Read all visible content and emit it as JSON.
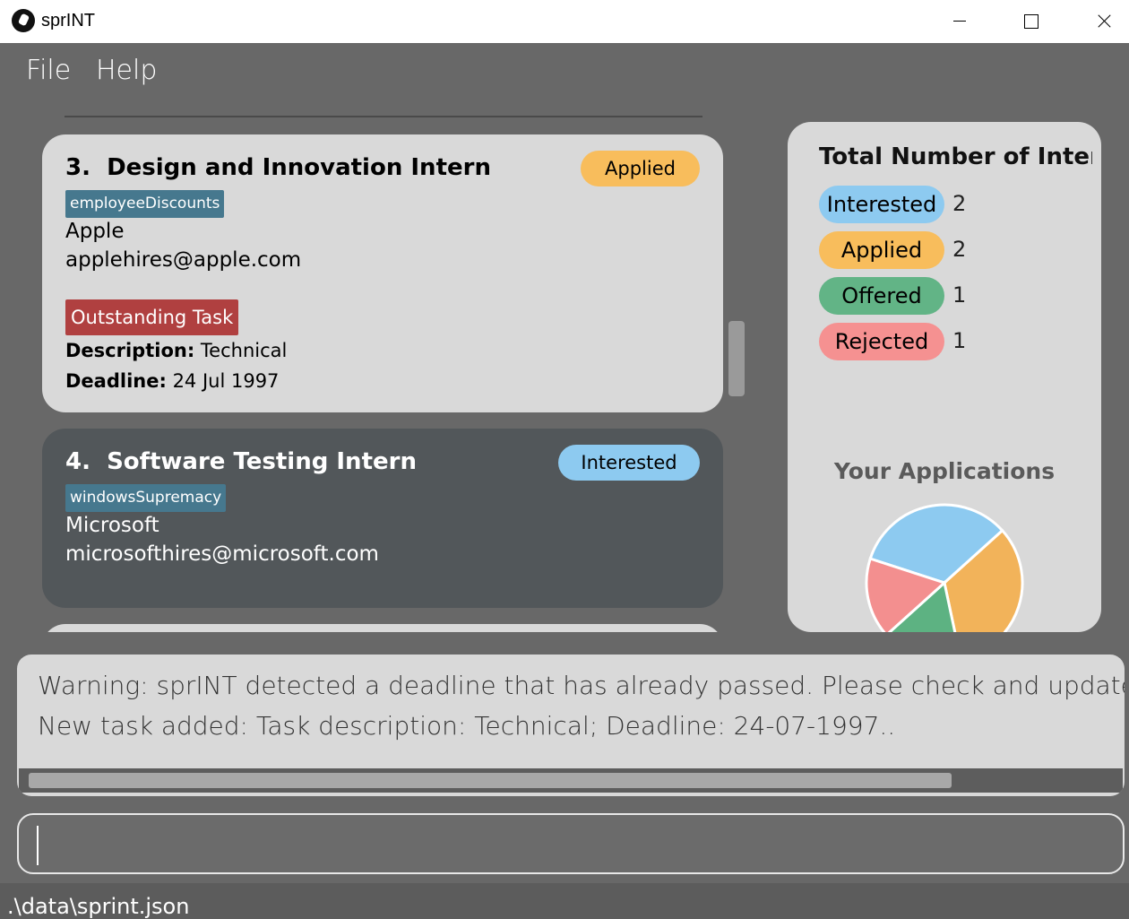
{
  "window": {
    "title": "sprINT",
    "icon": "runner-icon"
  },
  "menu": {
    "items": [
      "File",
      "Help"
    ]
  },
  "applications": [
    {
      "index": "3.",
      "role": "Design and Innovation Intern",
      "status": "Applied",
      "tag": "employeeDiscounts",
      "company": "Apple",
      "email": "applehires@apple.com",
      "task": {
        "badge": "Outstanding Task",
        "description_label": "Description:",
        "description": "Technical",
        "deadline_label": "Deadline:",
        "deadline": "24 Jul 1997"
      }
    },
    {
      "index": "4.",
      "role": "Software Testing Intern",
      "status": "Interested",
      "tag": "windowsSupremacy",
      "company": "Microsoft",
      "email": "microsofthires@microsoft.com"
    }
  ],
  "stats": {
    "title": "Total Number of Inter...",
    "rows": [
      {
        "label": "Interested",
        "count": "2",
        "color": "#8dcaf0"
      },
      {
        "label": "Applied",
        "count": "2",
        "color": "#f8bd5c"
      },
      {
        "label": "Offered",
        "count": "1",
        "color": "#62b486"
      },
      {
        "label": "Rejected",
        "count": "1",
        "color": "#f59191"
      }
    ],
    "chart_title": "Your Applications"
  },
  "chart_data": {
    "type": "pie",
    "title": "Your Applications",
    "categories": [
      "Interested",
      "Applied",
      "Offered",
      "Rejected"
    ],
    "values": [
      2,
      2,
      1,
      1
    ],
    "colors": [
      "#8dcaf0",
      "#f2b35a",
      "#5db282",
      "#f38f8f"
    ]
  },
  "result": {
    "lines": [
      "Warning: sprINT detected a deadline that has already passed. Please check and update task details.",
      "New task added: Task description: Technical; Deadline: 24-07-1997.."
    ]
  },
  "command": {
    "value": ""
  },
  "statusbar": {
    "path": ".\\data\\sprint.json"
  }
}
